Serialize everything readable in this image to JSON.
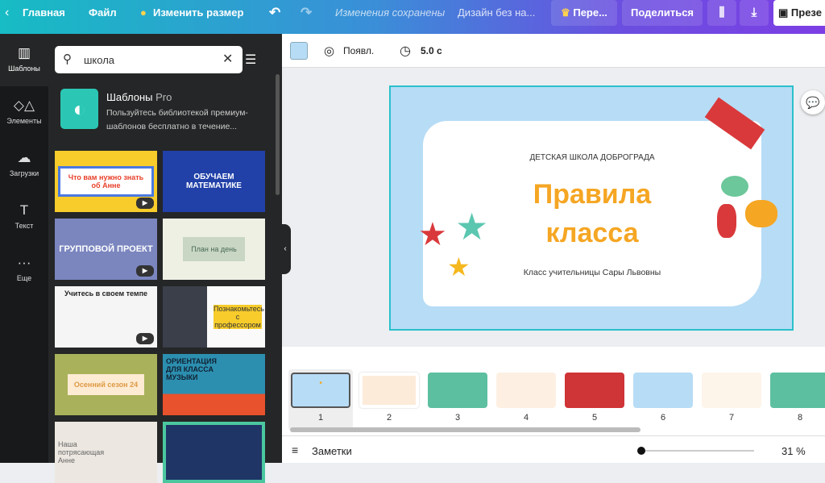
{
  "topbar": {
    "back": "Главная",
    "file": "Файл",
    "resize": "Изменить размер",
    "saved": "Изменения сохранены",
    "design_name": "Дизайн без на...",
    "upgrade": "Пере...",
    "share": "Поделиться",
    "present": "Презе"
  },
  "rail": [
    {
      "icon": "layout-icon",
      "label": "Шаблоны"
    },
    {
      "icon": "shapes-icon",
      "label": "Элементы"
    },
    {
      "icon": "upload-icon",
      "label": "Загрузки"
    },
    {
      "icon": "text-icon",
      "label": "Текст"
    },
    {
      "icon": "more-icon",
      "label": "Еще"
    }
  ],
  "search": {
    "value": "школа"
  },
  "promo": {
    "title": "Шаблоны",
    "pro": "Pro",
    "desc": "Пользуйтесь библиотекой премиум-шаблонов бесплатно в течение..."
  },
  "templates": [
    "Что вам нужно знать об Анне",
    "ОБУЧАЕМ МАТЕМАТИКЕ",
    "ГРУППОВОЙ ПРОЕКТ",
    "План на день",
    "Учитесь в своем темпе",
    "Познакомьтесь с профессором",
    "Осенний сезон 24",
    "ОРИЕНТАЦИЯ ДЛЯ КЛАССА МУЗЫКИ",
    "Наша потрясающая Анне",
    ""
  ],
  "toolbar": {
    "animate": "Появл.",
    "duration": "5.0 с"
  },
  "slide": {
    "school": "ДЕТСКАЯ ШКОЛА ДОБРОГРАДА",
    "title1": "Правила",
    "title2": "класса",
    "subtitle": "Класс учительницы Сары Львовны"
  },
  "pages": [
    "1",
    "2",
    "3",
    "4",
    "5",
    "6",
    "7",
    "8"
  ],
  "bottom": {
    "notes": "Заметки",
    "zoom": "31 %",
    "zoom_fraction": 0.31
  },
  "colors": {
    "accent": "#2bc0cc",
    "title": "#f5a623"
  }
}
